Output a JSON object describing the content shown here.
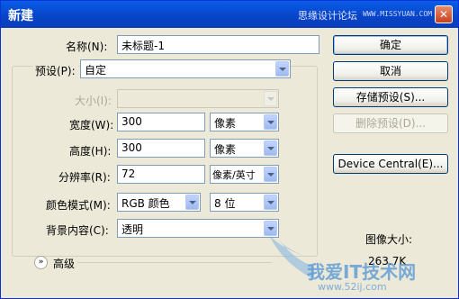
{
  "window": {
    "title": "新建",
    "site_cn": "思缘设计论坛",
    "site_url": "WWW.MISSYUAN.COM",
    "close_glyph": "✕"
  },
  "form": {
    "name_label": "名称(N):",
    "name_value": "未标题-1",
    "preset_label": "预设(P):",
    "preset_value": "自定",
    "size_label": "大小(I):",
    "size_value": "",
    "width_label": "宽度(W):",
    "width_value": "300",
    "width_unit": "像素",
    "height_label": "高度(H):",
    "height_value": "300",
    "height_unit": "像素",
    "resolution_label": "分辨率(R):",
    "resolution_value": "72",
    "resolution_unit": "像素/英寸",
    "color_mode_label": "颜色模式(M):",
    "color_mode_value": "RGB 颜色",
    "bit_depth_value": "8 位",
    "background_label": "背景内容(C):",
    "background_value": "透明",
    "advanced_label": "高级",
    "advanced_icon": "»"
  },
  "buttons": {
    "ok": "确定",
    "cancel": "取消",
    "save_preset": "存储预设(S)...",
    "delete_preset": "删除预设(D)...",
    "device_central": "Device Central(E)..."
  },
  "info": {
    "image_size_label": "图像大小:",
    "image_size_value": "263.7K"
  },
  "watermark": {
    "text": "我爱IT技术网",
    "url": "www.52ij.com"
  },
  "colors": {
    "titlebar": "#0a5de8",
    "dialog_bg": "#ece9d8",
    "field_border": "#7f9db9"
  }
}
